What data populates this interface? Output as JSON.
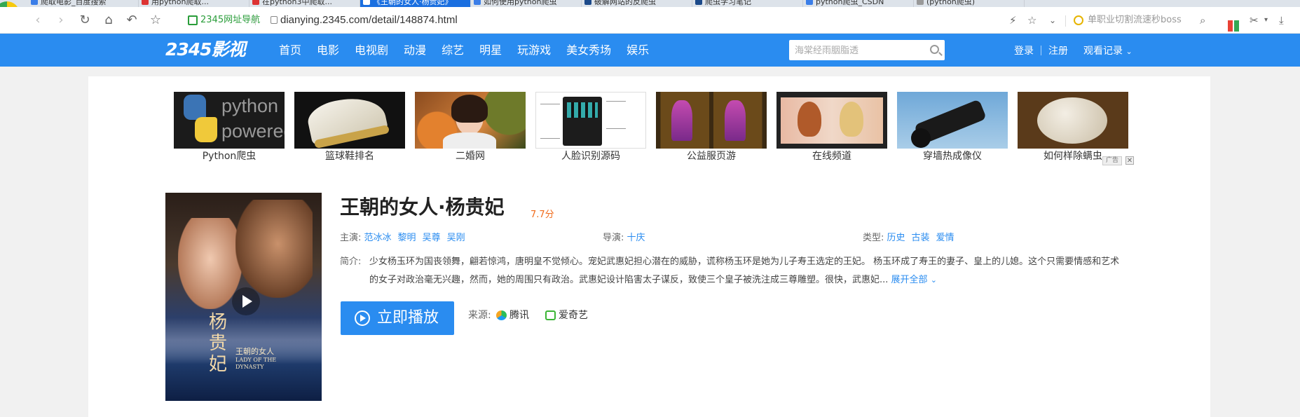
{
  "browser": {
    "tabs": [
      {
        "label": "爬取电影_百度搜索",
        "active": false
      },
      {
        "label": "用python爬取...",
        "active": false
      },
      {
        "label": "在python3中爬取...",
        "active": false
      },
      {
        "label": "《王朝的女人·杨贵妃》",
        "active": true
      },
      {
        "label": "如何使用python爬虫",
        "active": false
      },
      {
        "label": "破解网站的反爬虫",
        "active": false
      },
      {
        "label": "爬虫学习笔记",
        "active": false
      },
      {
        "label": "python爬虫_CSDN",
        "active": false
      },
      {
        "label": "(python爬虫)",
        "active": false
      }
    ],
    "site_nav_label": "2345网址导航",
    "url": "dianying.2345.com/detail/148874.html",
    "search_engine_text": "单职业切割流速秒boss"
  },
  "header": {
    "logo": "2345影视",
    "nav": [
      "首页",
      "电影",
      "电视剧",
      "动漫",
      "综艺",
      "明星",
      "玩游戏",
      "美女秀场",
      "娱乐"
    ],
    "search_placeholder": "海棠经雨胭脂透",
    "login": "登录",
    "register": "注册",
    "history": "观看记录"
  },
  "ads": {
    "items": [
      "Python爬虫",
      "篮球鞋排名",
      "二婚网",
      "人脸识别源码",
      "公益服页游",
      "在线频道",
      "穿墙热成像仪",
      "如何样除螨虫"
    ],
    "python_logo_line1": "python",
    "python_logo_line2": "powered",
    "ad_tag": "广告",
    "close": "✕"
  },
  "movie": {
    "title": "王朝的女人·杨贵妃",
    "score": "7.7分",
    "actors_label": "主演:",
    "actors": [
      "范冰冰",
      "黎明",
      "吴尊",
      "吴刚"
    ],
    "director_label": "导演:",
    "director": "十庆",
    "genre_label": "类型:",
    "genres": [
      "历史",
      "古装",
      "爱情"
    ],
    "intro_label": "简介:",
    "intro": "少女杨玉环为国丧领舞，翩若惊鸿，唐明皇不觉倾心。宠妃武惠妃担心潜在的威胁，谎称杨玉环是她为儿子寿王选定的王妃。 杨玉环成了寿王的妻子、皇上的儿媳。这个只需要情感和艺术的女子对政治毫无兴趣，然而，她的周围只有政治。武惠妃设计陷害太子谋反，致使三个皇子被洗注成三尊雕塑。很快，武惠妃...",
    "expand": "展开全部",
    "play_button": "立即播放",
    "source_label": "来源:",
    "sources": [
      "腾讯",
      "爱奇艺"
    ],
    "poster_title_en": "LADY OF THE DYNASTY",
    "poster_title_cn": "杨贵妃",
    "poster_subtitle_cn": "王朝的女人"
  },
  "colors": {
    "brand": "#2a8cf0",
    "score": "#f06a1a",
    "link": "#2a8cf0"
  }
}
